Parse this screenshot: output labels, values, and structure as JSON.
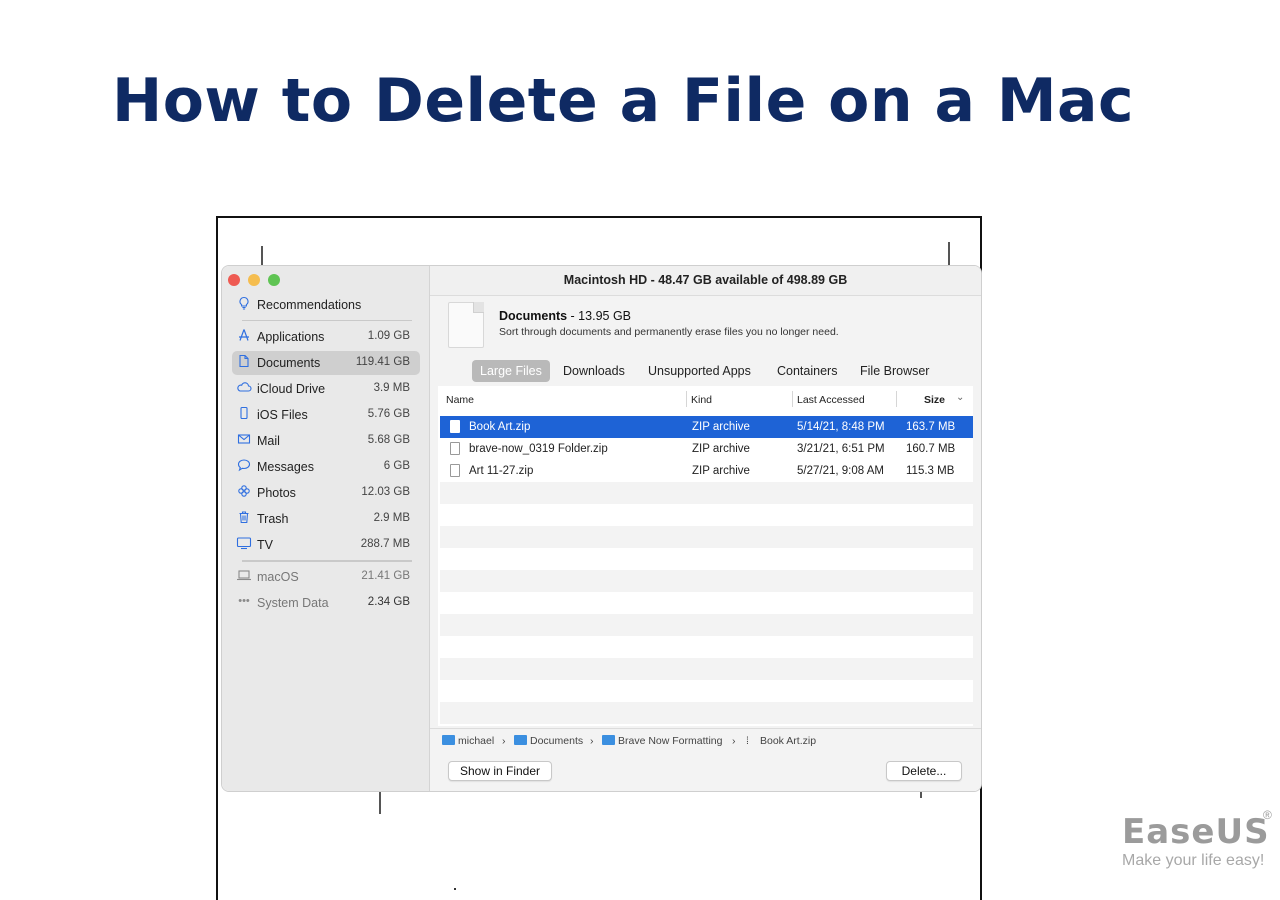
{
  "headline": "How to Delete a File on a Mac",
  "window": {
    "title": "Macintosh HD - 48.47 GB available of 498.89 GB"
  },
  "sidebar": {
    "recommendations": "Recommendations",
    "items": [
      {
        "label": "Applications",
        "size": "1.09 GB",
        "icon": "applications-icon"
      },
      {
        "label": "Documents",
        "size": "119.41 GB",
        "icon": "document-icon"
      },
      {
        "label": "iCloud Drive",
        "size": "3.9 MB",
        "icon": "cloud-icon"
      },
      {
        "label": "iOS Files",
        "size": "5.76 GB",
        "icon": "phone-icon"
      },
      {
        "label": "Mail",
        "size": "5.68 GB",
        "icon": "mail-icon"
      },
      {
        "label": "Messages",
        "size": "6 GB",
        "icon": "message-icon"
      },
      {
        "label": "Photos",
        "size": "12.03 GB",
        "icon": "photos-icon"
      },
      {
        "label": "Trash",
        "size": "2.9 MB",
        "icon": "trash-icon"
      },
      {
        "label": "TV",
        "size": "288.7 MB",
        "icon": "tv-icon"
      }
    ],
    "system_items": [
      {
        "label": "macOS",
        "size": "21.41 GB",
        "icon": "laptop-icon"
      },
      {
        "label": "System Data",
        "size": "2.34 GB",
        "icon": "ellipsis-icon"
      }
    ]
  },
  "category": {
    "name": "Documents",
    "size": " - 13.95 GB",
    "description": "Sort through documents and permanently erase files you no longer need."
  },
  "tabs": [
    "Large Files",
    "Downloads",
    "Unsupported Apps",
    "Containers",
    "File Browser"
  ],
  "table": {
    "headers": {
      "name": "Name",
      "kind": "Kind",
      "last_accessed": "Last Accessed",
      "size": "Size"
    },
    "rows": [
      {
        "name": "Book Art.zip",
        "kind": "ZIP archive",
        "last_accessed": "5/14/21, 8:48 PM",
        "size": "163.7 MB"
      },
      {
        "name": "brave-now_0319 Folder.zip",
        "kind": "ZIP archive",
        "last_accessed": "3/21/21, 6:51 PM",
        "size": "160.7 MB"
      },
      {
        "name": "Art 11-27.zip",
        "kind": "ZIP archive",
        "last_accessed": "5/27/21, 9:08 AM",
        "size": "115.3 MB"
      }
    ]
  },
  "path": {
    "user": "michael",
    "folder1": "Documents",
    "folder2": "Brave Now Formatting",
    "file": "Book Art.zip",
    "separator": "›"
  },
  "buttons": {
    "show_in_finder": "Show in Finder",
    "delete": "Delete..."
  },
  "brand": {
    "logo": "EaseUS",
    "registered": "®",
    "tagline": "Make your life easy!"
  },
  "colors": {
    "headline": "#0f2a63",
    "selection": "#1e63d6",
    "accent_icon": "#2f6fe0"
  }
}
